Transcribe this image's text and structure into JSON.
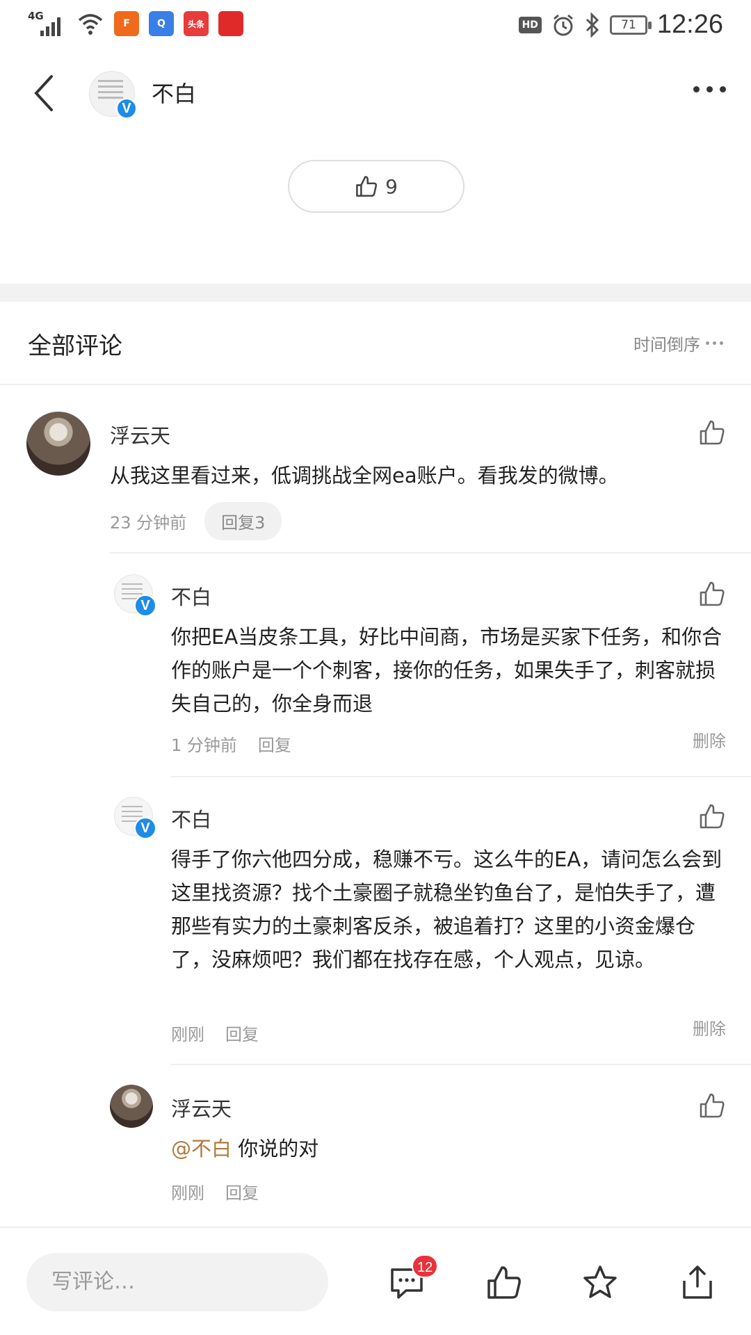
{
  "status_bar": {
    "network_label": "4G",
    "app_icons": [
      {
        "name": "app-f-icon",
        "text": "F",
        "color": "#f06a1c"
      },
      {
        "name": "app-q-icon",
        "text": "Q",
        "color": "#3a7ee8"
      },
      {
        "name": "toutiao-icon",
        "text": "头条",
        "color": "#e83b3b"
      },
      {
        "name": "app-red-icon",
        "text": "",
        "color": "#e02a2a"
      }
    ],
    "hd_label": "HD",
    "battery": "71",
    "time": "12:26"
  },
  "header": {
    "name": "不白"
  },
  "like": {
    "count": "9"
  },
  "comments_section": {
    "title": "全部评论",
    "sort_label": "时间倒序"
  },
  "comments": [
    {
      "name": "浮云天",
      "text": "从我这里看过来，低调挑战全网ea账户。看我发的微博。",
      "time": "23 分钟前",
      "reply_label": "回复3"
    },
    {
      "name": "不白",
      "text": "你把EA当皮条工具，好比中间商，市场是买家下任务，和你合作的账户是一个个刺客，接你的任务，如果失手了，刺客就损失自己的，你全身而退",
      "time": "1 分钟前",
      "reply_label": "回复",
      "delete_label": "删除"
    },
    {
      "name": "不白",
      "text": "得手了你六他四分成，稳赚不亏。这么牛的EA，请问怎么会到这里找资源？找个土豪圈子就稳坐钓鱼台了，是怕失手了，遭那些有实力的土豪刺客反杀，被追着打？这里的小资金爆仓了，没麻烦吧？我们都在找存在感，个人观点，见谅。",
      "time": "刚刚",
      "reply_label": "回复",
      "delete_label": "删除"
    },
    {
      "name": "浮云天",
      "mention": "@不白",
      "text": "你说的对",
      "time": "刚刚",
      "reply_label": "回复"
    }
  ],
  "bottom_bar": {
    "input_placeholder": "写评论…",
    "comment_count": "12"
  },
  "colors": {
    "verified_blue": "#1f8ce6",
    "mention": "#b07a3e",
    "badge_red": "#e8333c"
  }
}
